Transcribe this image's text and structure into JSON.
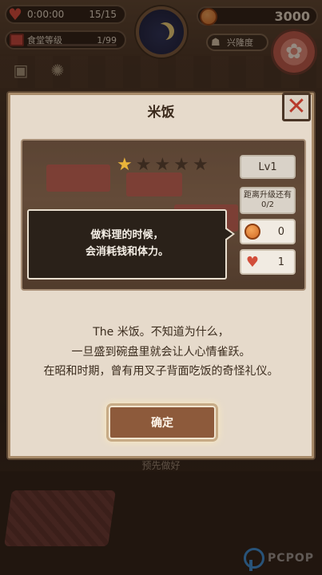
{
  "hud": {
    "energy_timer": "0:00:00",
    "energy_count": "15/15",
    "restaurant_level_label": "食堂等级",
    "restaurant_level_count": "1/99",
    "coins": "3000",
    "popularity_label": "兴隆度"
  },
  "modal": {
    "title": "米饭",
    "close_symbol": "✕",
    "rating": {
      "filled": 1,
      "total": 5
    },
    "level": "Lv1",
    "upgrade_label_line1": "距离升级还有",
    "upgrade_progress": "0/2",
    "cost_coin": "0",
    "cost_heart": "1",
    "tooltip_line1": "做料理的时候，",
    "tooltip_line2": "会消耗钱和体力。",
    "description_line1": "The 米饭。不知道为什么，",
    "description_line2": "一旦盛到碗盘里就会让人心情雀跃。",
    "description_line3": "在昭和时期，曾有用叉子背面吃饭的奇怪礼仪。",
    "confirm_label": "确定"
  },
  "background": {
    "prepare_label": "预先做好"
  },
  "watermark": "PCPOP"
}
